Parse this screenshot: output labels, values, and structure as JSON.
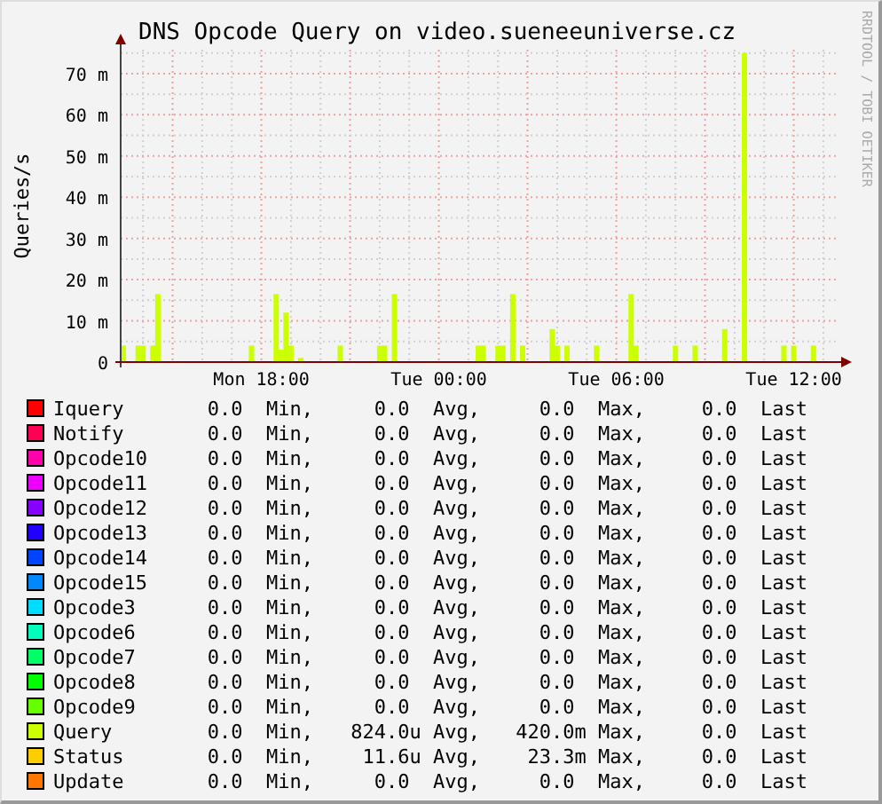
{
  "chart": {
    "chart_data": {
      "type": "bar",
      "title": "DNS Opcode Query on video.sueneeuniverse.cz",
      "ylabel": "Queries/s",
      "categories": [
        null,
        null,
        null,
        null,
        null,
        null,
        null,
        null,
        null,
        null,
        null,
        null,
        null,
        null,
        null,
        null,
        null,
        null,
        null,
        null,
        null,
        null,
        null,
        null,
        null,
        null,
        null,
        null,
        "Mon 18:00",
        null,
        null,
        null,
        null,
        null,
        null,
        null,
        null,
        null,
        null,
        null,
        null,
        null,
        null,
        null,
        null,
        null,
        null,
        null,
        null,
        null,
        null,
        null,
        null,
        null,
        null,
        null,
        null,
        null,
        null,
        null,
        null,
        null,
        null,
        null,
        "Tue 00:00",
        null,
        null,
        null,
        null,
        null,
        null,
        null,
        null,
        null,
        null,
        null,
        null,
        null,
        null,
        null,
        null,
        null,
        null,
        null,
        null,
        null,
        null,
        null,
        null,
        null,
        null,
        null,
        null,
        null,
        null,
        null,
        null,
        null,
        null,
        null,
        "Tue 06:00",
        null,
        null,
        null,
        null,
        null,
        null,
        null,
        null,
        null,
        null,
        null,
        null,
        null,
        null,
        null,
        null,
        null,
        null,
        null,
        null,
        null,
        null,
        null,
        null,
        null,
        null,
        null,
        null,
        null,
        null,
        null,
        null,
        null,
        null,
        null,
        "Tue 12:00",
        null,
        null,
        null,
        null,
        null,
        null,
        null,
        null
      ],
      "series": [
        {
          "color": "#ccff00",
          "values": [
            4,
            0,
            0,
            4,
            4,
            0,
            4,
            16.5,
            0,
            0,
            0,
            0,
            0,
            0,
            0,
            0,
            0,
            0,
            0,
            0,
            0,
            0,
            0,
            0,
            0,
            0,
            4,
            0,
            0,
            0,
            0,
            16.5,
            3,
            12,
            4,
            0,
            1,
            0,
            0,
            0,
            0,
            0,
            0,
            0,
            4,
            0,
            0,
            0,
            0,
            0,
            0,
            0,
            4,
            4,
            0,
            16.5,
            0,
            0,
            0,
            0,
            0,
            0,
            0,
            0,
            0,
            0,
            0,
            0,
            0,
            0,
            0,
            0,
            4,
            4,
            0,
            0,
            4,
            4,
            0,
            16.5,
            0,
            4,
            0,
            0,
            0,
            0,
            0,
            8,
            4,
            0,
            4,
            0,
            0,
            0,
            0,
            0,
            4,
            0,
            0,
            0,
            0,
            0,
            0,
            16.5,
            4,
            0,
            0,
            0,
            0,
            0,
            0,
            0,
            4,
            0,
            0,
            0,
            4,
            0,
            0,
            0,
            0,
            0,
            8,
            0,
            0,
            0,
            75,
            0,
            0,
            0,
            0,
            0,
            0,
            0,
            4,
            0,
            4,
            0,
            0,
            0,
            4,
            0,
            0,
            0,
            0
          ]
        }
      ],
      "ylim": [
        0,
        75.8
      ],
      "grid": true,
      "yticks": [
        {
          "value": 0,
          "label": "0"
        },
        {
          "value": 10,
          "label": "10 m"
        },
        {
          "value": 20,
          "label": "20 m"
        },
        {
          "value": 30,
          "label": "30 m"
        },
        {
          "value": 40,
          "label": "40 m"
        },
        {
          "value": 50,
          "label": "50 m"
        },
        {
          "value": 60,
          "label": "60 m"
        },
        {
          "value": 70,
          "label": "70 m"
        }
      ]
    },
    "watermark": "RRDTOOL / TOBI OETIKER"
  },
  "legend": [
    {
      "name": "Iquery",
      "color": "#ff0000",
      "stats": [
        "0.0  Min,",
        "0.0  Avg,",
        "0.0  Max,",
        "0.0  Last"
      ]
    },
    {
      "name": "Notify",
      "color": "#ff0055",
      "stats": [
        "0.0  Min,",
        "0.0  Avg,",
        "0.0  Max,",
        "0.0  Last"
      ]
    },
    {
      "name": "Opcode10",
      "color": "#ff00aa",
      "stats": [
        "0.0  Min,",
        "0.0  Avg,",
        "0.0  Max,",
        "0.0  Last"
      ]
    },
    {
      "name": "Opcode11",
      "color": "#ee00ff",
      "stats": [
        "0.0  Min,",
        "0.0  Avg,",
        "0.0  Max,",
        "0.0  Last"
      ]
    },
    {
      "name": "Opcode12",
      "color": "#8800ff",
      "stats": [
        "0.0  Min,",
        "0.0  Avg,",
        "0.0  Max,",
        "0.0  Last"
      ]
    },
    {
      "name": "Opcode13",
      "color": "#2200ff",
      "stats": [
        "0.0  Min,",
        "0.0  Avg,",
        "0.0  Max,",
        "0.0  Last"
      ]
    },
    {
      "name": "Opcode14",
      "color": "#0044ff",
      "stats": [
        "0.0  Min,",
        "0.0  Avg,",
        "0.0  Max,",
        "0.0  Last"
      ]
    },
    {
      "name": "Opcode15",
      "color": "#0088ff",
      "stats": [
        "0.0  Min,",
        "0.0  Avg,",
        "0.0  Max,",
        "0.0  Last"
      ]
    },
    {
      "name": "Opcode3",
      "color": "#00ddff",
      "stats": [
        "0.0  Min,",
        "0.0  Avg,",
        "0.0  Max,",
        "0.0  Last"
      ]
    },
    {
      "name": "Opcode6",
      "color": "#00ffbb",
      "stats": [
        "0.0  Min,",
        "0.0  Avg,",
        "0.0  Max,",
        "0.0  Last"
      ]
    },
    {
      "name": "Opcode7",
      "color": "#00ff66",
      "stats": [
        "0.0  Min,",
        "0.0  Avg,",
        "0.0  Max,",
        "0.0  Last"
      ]
    },
    {
      "name": "Opcode8",
      "color": "#00ff00",
      "stats": [
        "0.0  Min,",
        "0.0  Avg,",
        "0.0  Max,",
        "0.0  Last"
      ]
    },
    {
      "name": "Opcode9",
      "color": "#66ff00",
      "stats": [
        "0.0  Min,",
        "0.0  Avg,",
        "0.0  Max,",
        "0.0  Last"
      ]
    },
    {
      "name": "Query",
      "color": "#ccff00",
      "stats": [
        "0.0  Min,",
        "824.0u Avg,",
        "420.0m Max,",
        "0.0  Last"
      ]
    },
    {
      "name": "Status",
      "color": "#ffcc00",
      "stats": [
        "0.0  Min,",
        "11.6u Avg,",
        "23.3m Max,",
        "0.0  Last"
      ]
    },
    {
      "name": "Update",
      "color": "#ff7700",
      "stats": [
        "0.0  Min,",
        "0.0  Avg,",
        "0.0  Max,",
        "0.0  Last"
      ]
    }
  ]
}
